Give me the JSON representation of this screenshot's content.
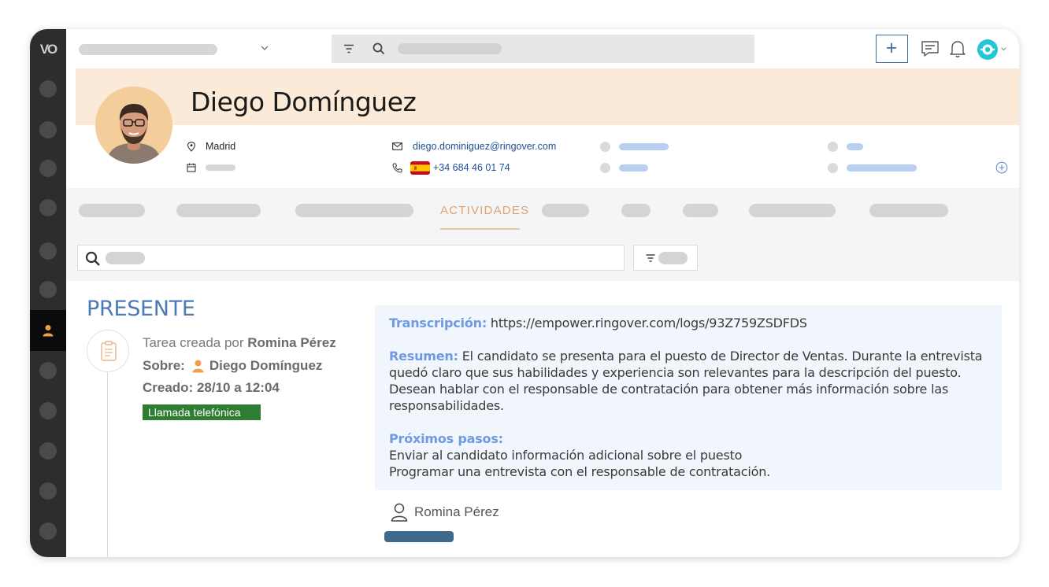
{
  "app": {
    "logo_text": "VO"
  },
  "topbar": {
    "plus_label": "+",
    "icons": [
      "chevron-down-icon",
      "filter-icon",
      "search-icon",
      "plus-icon",
      "chat-icon",
      "bell-icon",
      "user-status-icon"
    ]
  },
  "contact": {
    "name": "Diego Domínguez",
    "city": "Madrid",
    "email": "diego.dominiguez@ringover.com",
    "phone": "+34 684 46 01 74"
  },
  "tabs": {
    "active_label": "ACTIVIDADES"
  },
  "activity": {
    "section_title": "PRESENTE",
    "created_by_prefix": "Tarea creada por",
    "created_by_name": "Romina Pérez",
    "about_label": "Sobre:",
    "about_name": "Diego Domínguez",
    "created_label": "Creado: 28/10 a 12:04",
    "tag_label": "Llamada telefónica",
    "transcript_label": "Transcripción:",
    "transcript_url": "https://empower.ringover.com/logs/93Z759ZSDFDS",
    "summary_label": "Resumen:",
    "summary_text": "El candidato se presenta para el puesto de Director de Ventas. Durante la entrevista quedó claro que sus habilidades y experiencia son relevantes para la descripción del puesto. Desean hablar con el responsable de contratación para obtener más información sobre las responsabilidades.",
    "next_steps_label": "Próximos pasos:",
    "next_step_1": "Enviar al candidato información adicional sobre el puesto",
    "next_step_2": "Programar una entrevista con el responsable de contratación.",
    "author_name": "Romina Pérez"
  },
  "colors": {
    "accent": "#e0a36c",
    "tag_green": "#2e7d32",
    "link_blue": "#1f4e96",
    "title_blue": "#4d79b5"
  }
}
